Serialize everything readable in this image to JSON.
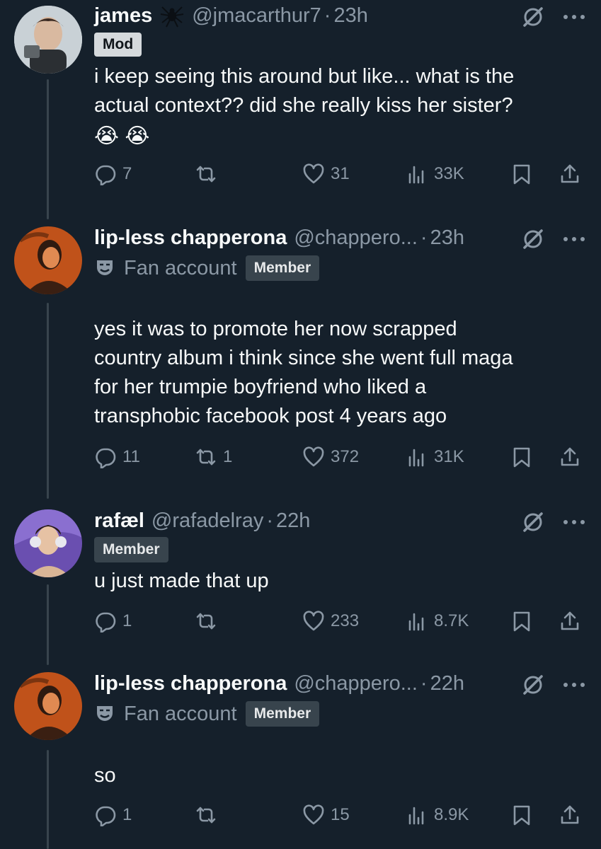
{
  "colors": {
    "background": "#15202b",
    "text": "#f7f9f9",
    "muted": "#8b98a5",
    "badge_bg": "#38444d",
    "line": "#38444d"
  },
  "posts": [
    {
      "name": "james",
      "handle": "@jmacarthur7",
      "dot": "·",
      "time": "23h",
      "badge": "Mod",
      "text_lines": [
        "i keep seeing this around but like... what is the",
        "actual context?? did she really kiss her sister?"
      ],
      "emoji": "😭 😭",
      "replies": "7",
      "reposts": "",
      "likes": "31",
      "views": "33K"
    },
    {
      "name": "lip-less chapperona",
      "handle": "@chappero...",
      "dot": "·",
      "time": "23h",
      "fan_label": "Fan account",
      "badge": "Member",
      "text_lines": [
        "yes it was to promote her now scrapped",
        "country album i think since she went full maga",
        "for her trumpie boyfriend who liked a",
        "transphobic facebook post 4 years ago"
      ],
      "replies": "11",
      "reposts": "1",
      "likes": "372",
      "views": "31K"
    },
    {
      "name": "rafæl",
      "handle": "@rafadelray",
      "dot": "·",
      "time": "22h",
      "badge": "Member",
      "text_lines": [
        "u just made that up"
      ],
      "replies": "1",
      "reposts": "",
      "likes": "233",
      "views": "8.7K"
    },
    {
      "name": "lip-less chapperona",
      "handle": "@chappero...",
      "dot": "·",
      "time": "22h",
      "fan_label": "Fan account",
      "badge": "Member",
      "text_lines": [
        "so"
      ],
      "replies": "1",
      "reposts": "",
      "likes": "15",
      "views": "8.9K"
    }
  ]
}
